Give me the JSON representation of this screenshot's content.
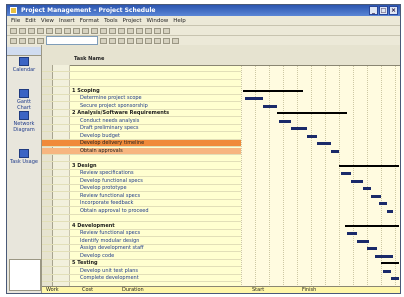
{
  "window": {
    "title": "Project Management – Project Schedule"
  },
  "menus": [
    "File",
    "Edit",
    "View",
    "Insert",
    "Format",
    "Tools",
    "Project",
    "Window",
    "Help"
  ],
  "viewbar": {
    "items": [
      {
        "label": "Calendar",
        "icon": "calendar-icon"
      },
      {
        "label": "Gantt Chart",
        "icon": "gantt-icon"
      },
      {
        "label": "Network Diagram",
        "icon": "network-icon"
      },
      {
        "label": "Task Usage",
        "icon": "task-usage-icon"
      }
    ]
  },
  "grid": {
    "header_label": "Task Name",
    "rows": [
      {
        "name": "",
        "type": "blank"
      },
      {
        "name": "",
        "type": "blank"
      },
      {
        "name": "",
        "type": "blank"
      },
      {
        "name": "1 Scoping",
        "type": "summary"
      },
      {
        "name": "Determine project scope",
        "type": "sub"
      },
      {
        "name": "Secure project sponsorship",
        "type": "sub"
      },
      {
        "name": "2 Analysis/Software Requirements",
        "type": "summary"
      },
      {
        "name": "Conduct needs analysis",
        "type": "sub"
      },
      {
        "name": "Draft preliminary specs",
        "type": "sub"
      },
      {
        "name": "Develop budget",
        "type": "sub"
      },
      {
        "name": "Develop delivery timeline",
        "type": "sel"
      },
      {
        "name": "Obtain approvals",
        "type": "sel2"
      },
      {
        "name": "",
        "type": "blank"
      },
      {
        "name": "3 Design",
        "type": "summary"
      },
      {
        "name": "Review specifications",
        "type": "sub"
      },
      {
        "name": "Develop functional specs",
        "type": "sub"
      },
      {
        "name": "Develop prototype",
        "type": "sub"
      },
      {
        "name": "Review functional specs",
        "type": "sub"
      },
      {
        "name": "Incorporate feedback",
        "type": "sub"
      },
      {
        "name": "Obtain approval to proceed",
        "type": "sub"
      },
      {
        "name": "",
        "type": "blank"
      },
      {
        "name": "4 Development",
        "type": "summary"
      },
      {
        "name": "Review functional specs",
        "type": "sub"
      },
      {
        "name": "Identify modular design",
        "type": "sub"
      },
      {
        "name": "Assign development staff",
        "type": "sub"
      },
      {
        "name": "Develop code",
        "type": "sub"
      },
      {
        "name": "5 Testing",
        "type": "summary"
      },
      {
        "name": "Develop unit test plans",
        "type": "sub"
      },
      {
        "name": "Complete development",
        "type": "sub"
      }
    ]
  },
  "footer": {
    "labels": [
      "Work",
      "Cost",
      "Duration",
      "Start",
      "Finish"
    ]
  },
  "colors": {
    "selected_row": "#f08a3a",
    "gantt_bar": "#1a2a6a",
    "grid_bg": "#ffffd0"
  }
}
